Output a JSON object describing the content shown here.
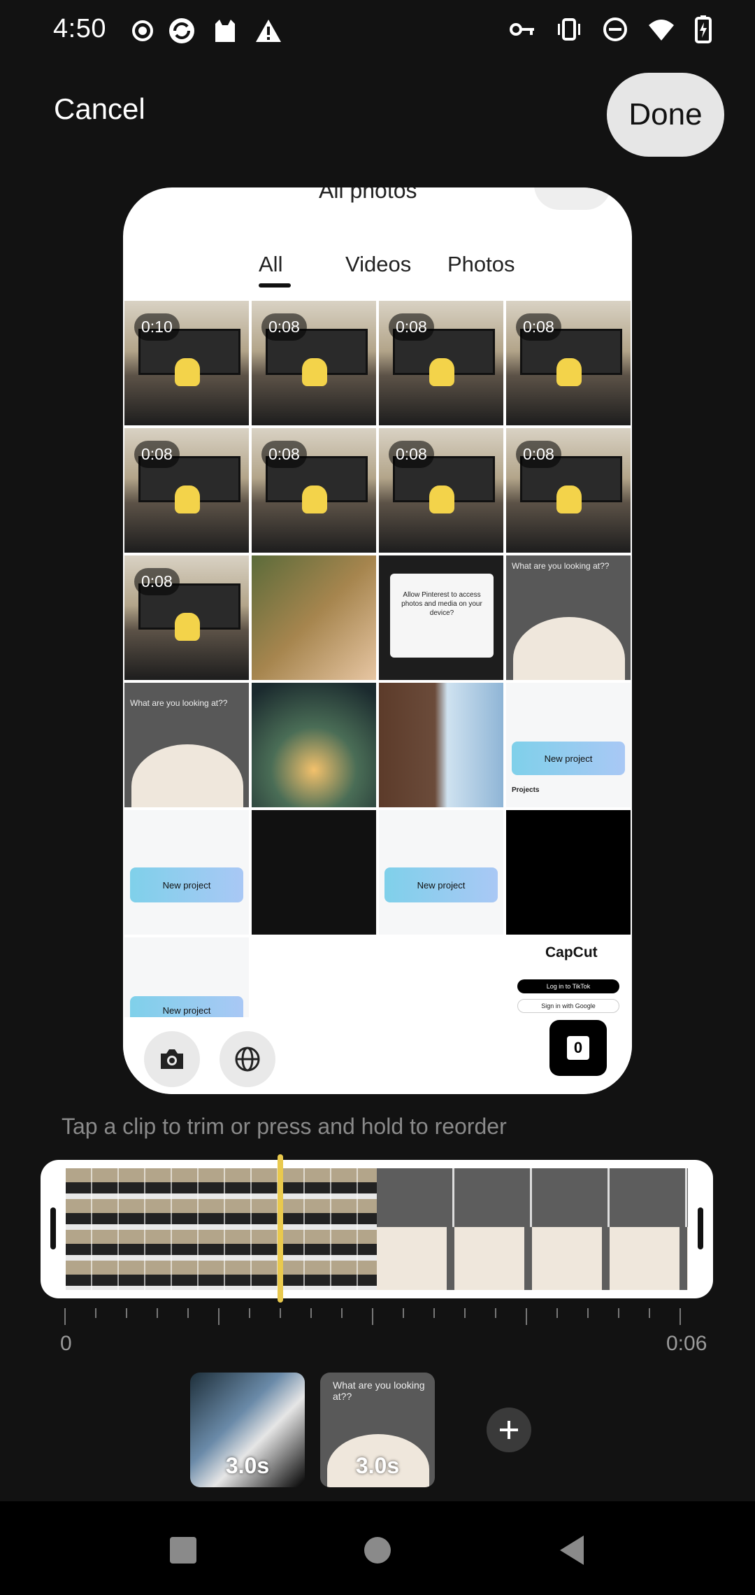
{
  "status_bar": {
    "time": "4:50",
    "left_icons": [
      "record-icon",
      "sync-icon",
      "cat-icon",
      "warning-icon"
    ],
    "right_icons": [
      "key-icon",
      "vibrate-icon",
      "dnd-icon",
      "wifi-icon",
      "battery-icon"
    ]
  },
  "header": {
    "cancel_label": "Cancel",
    "done_label": "Done"
  },
  "preview": {
    "top_title": "All photos",
    "tabs": [
      "All",
      "Videos",
      "Photos"
    ],
    "selected_tab": "All",
    "durations": [
      "0:10",
      "0:08",
      "0:08",
      "0:08",
      "0:08",
      "0:08",
      "0:08",
      "0:08",
      "0:08"
    ],
    "dialog_text": "Allow Pinterest to access photos and media on your device?",
    "thumb_caption": "What are you looking at??",
    "new_project_label": "New project",
    "projects_label": "Projects",
    "capcut_logo": "CapCut",
    "login_tiktok": "Log in to TikTok",
    "signin_google": "Sign in with Google",
    "folder_count": "0"
  },
  "hint": "Tap a clip to trim or press and hold to reorder",
  "ruler": {
    "start": "0",
    "end": "0:06"
  },
  "clips": [
    {
      "label": "3.0s"
    },
    {
      "label": "3.0s"
    }
  ],
  "colors": {
    "background": "#121212",
    "playhead": "#e9c94d",
    "done_button": "#e6e6e6"
  }
}
